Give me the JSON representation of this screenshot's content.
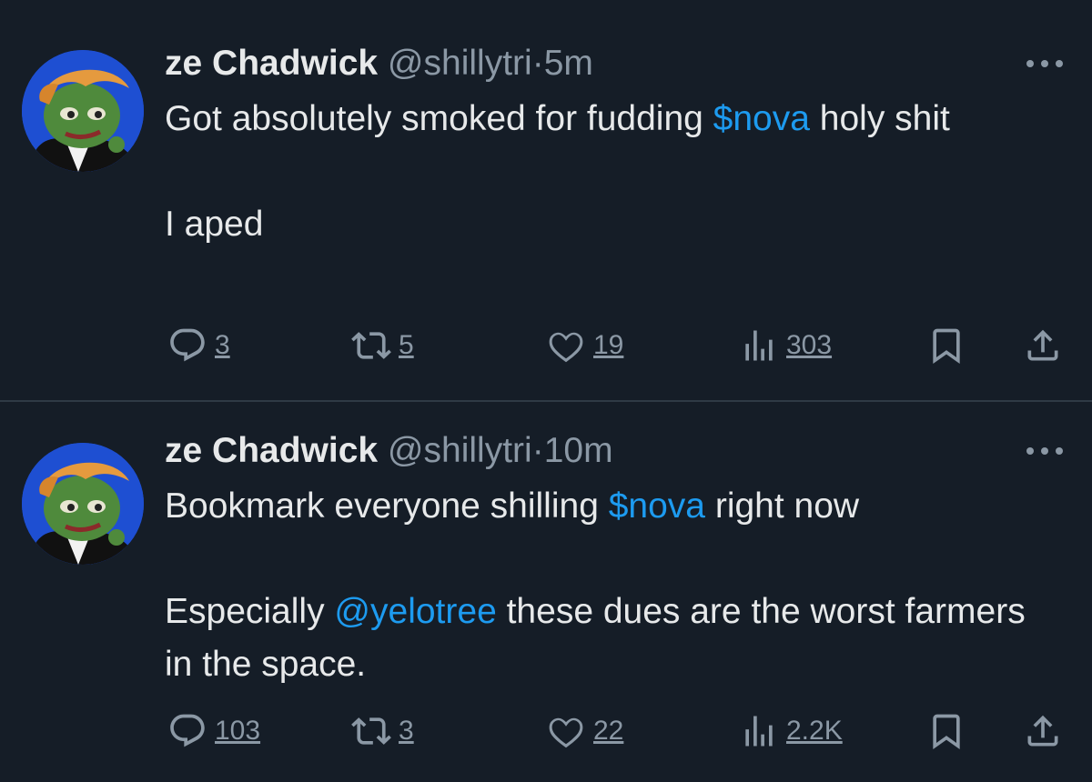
{
  "tweets": [
    {
      "display_name": "ze Chadwick",
      "handle": "@shillytri",
      "separator": "·",
      "time": "5m",
      "body": {
        "p1": {
          "before": "Got absolutely smoked for fudding ",
          "link": "$nova",
          "after": " holy shit"
        },
        "p2": "I aped"
      },
      "stats": {
        "replies": "3",
        "reposts": "5",
        "likes": "19",
        "views": "303"
      }
    },
    {
      "display_name": "ze Chadwick",
      "handle": "@shillytri",
      "separator": "·",
      "time": "10m",
      "body": {
        "p1": {
          "before": "Bookmark everyone shilling ",
          "link": "$nova",
          "after": " right now"
        },
        "p2": {
          "before": "Especially ",
          "link": "@yelotree",
          "after": " these dues are the worst farmers in the space."
        }
      },
      "stats": {
        "replies": "103",
        "reposts": "3",
        "likes": "22",
        "views": "2.2K"
      }
    }
  ],
  "icons": {
    "reply": "reply-icon",
    "repost": "repost-icon",
    "like": "heart-icon",
    "views": "views-icon",
    "bookmark": "bookmark-icon",
    "share": "share-icon",
    "more": "more-icon"
  },
  "colors": {
    "background": "#151d27",
    "text": "#e7e9ea",
    "muted": "#8b98a5",
    "link": "#1d9bf0",
    "divider": "#2f3a45",
    "avatar_bg": "#1e4fd2"
  }
}
